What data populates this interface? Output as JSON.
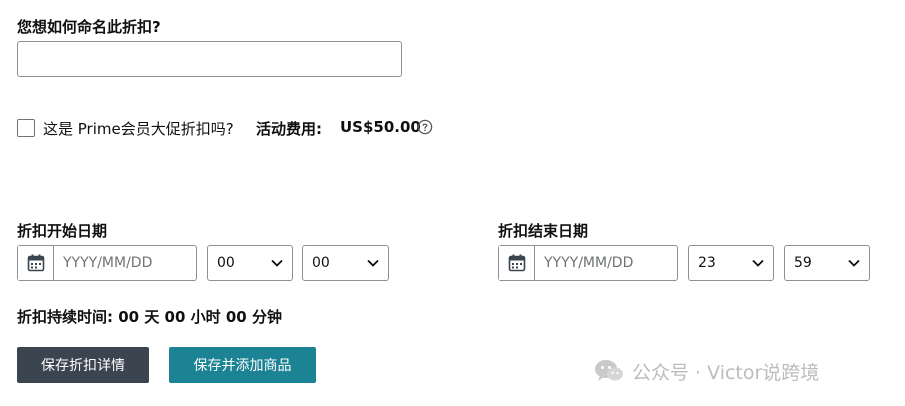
{
  "name_section": {
    "label": "您想如何命名此折扣?",
    "input_value": "",
    "input_placeholder": ""
  },
  "prime": {
    "checkbox_checked": false,
    "label": "这是 Prime会员大促折扣吗?",
    "fee_label": "活动费用:",
    "fee_value": "US$50.00"
  },
  "start": {
    "label": "折扣开始日期",
    "date_placeholder": "YYYY/MM/DD",
    "hour": "00",
    "minute": "00"
  },
  "end": {
    "label": "折扣结束日期",
    "date_placeholder": "YYYY/MM/DD",
    "hour": "23",
    "minute": "59"
  },
  "duration": {
    "text": "折扣持续时间: 00 天 00 小时 00 分钟"
  },
  "buttons": {
    "save_details": "保存折扣详情",
    "save_and_add": "保存并添加商品"
  },
  "watermark": {
    "text": "公众号 · Victor说跨境",
    "icon": "wechat-icon"
  },
  "colors": {
    "dark_button": "#3a4550",
    "teal_button": "#1b8394",
    "border": "#8d9096",
    "watermark": "#bcbcbc"
  }
}
